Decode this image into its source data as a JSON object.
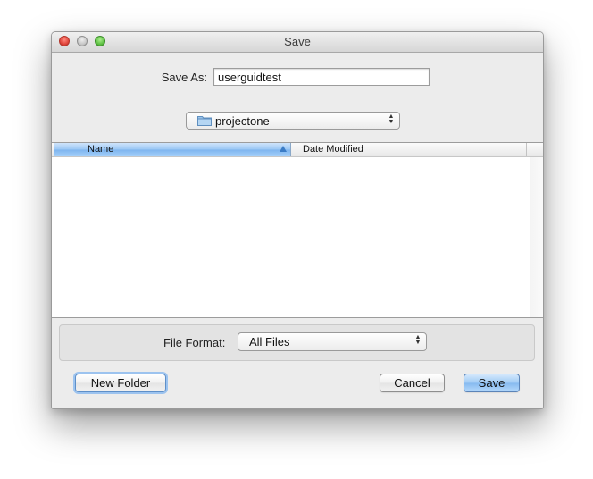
{
  "window": {
    "title": "Save"
  },
  "save_as": {
    "label": "Save As:",
    "value": "userguidtest"
  },
  "location": {
    "folder_name": "projectone",
    "icon": "folder-icon"
  },
  "file_list": {
    "columns": [
      {
        "label": "Name",
        "sorted": true,
        "sort_direction": "ascending"
      },
      {
        "label": "Date Modified"
      }
    ],
    "rows": []
  },
  "file_format": {
    "label": "File Format:",
    "selected": "All Files"
  },
  "buttons": {
    "new_folder": "New Folder",
    "cancel": "Cancel",
    "save": "Save"
  },
  "colors": {
    "accent": "#85b9ef",
    "header_selected": "#98c6f4",
    "window_bg": "#ececec"
  }
}
